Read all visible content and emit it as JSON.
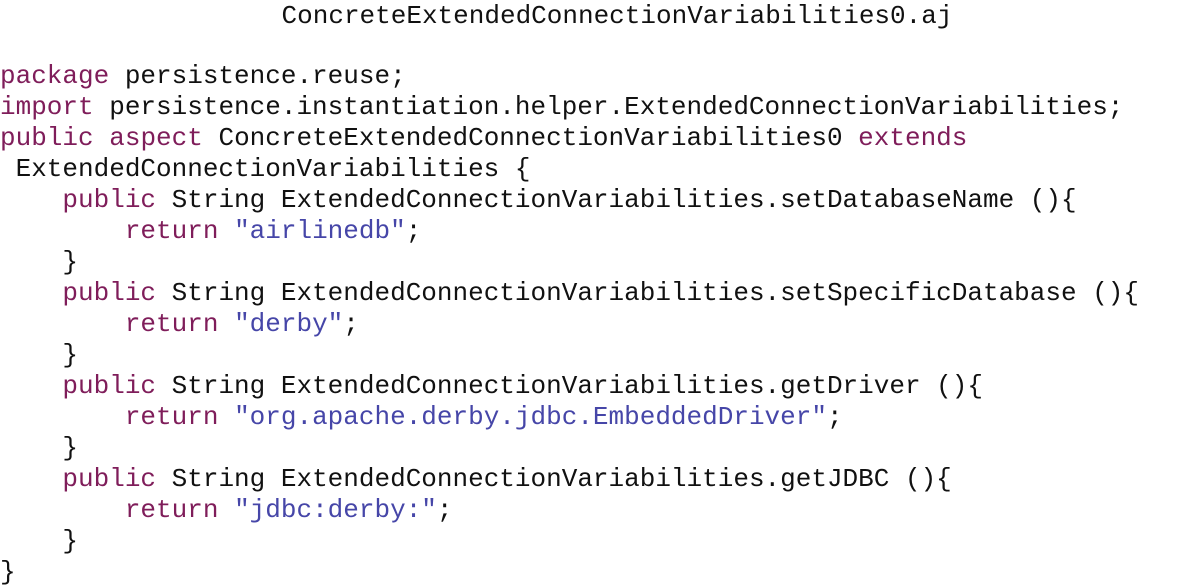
{
  "document": {
    "title": "ConcreteExtendedConnectionVariabilities0.aj",
    "colors": {
      "keyword": "#7f1d5a",
      "string": "#4646a8",
      "text": "#111111",
      "background": "#ffffff"
    },
    "lines": [
      [
        {
          "t": "kw",
          "v": "package"
        },
        {
          "t": "plain",
          "v": " persistence.reuse;"
        }
      ],
      [
        {
          "t": "kw",
          "v": "import"
        },
        {
          "t": "plain",
          "v": " persistence.instantiation.helper.ExtendedConnectionVariabilities;"
        }
      ],
      [
        {
          "t": "kw",
          "v": "public"
        },
        {
          "t": "plain",
          "v": " "
        },
        {
          "t": "kw",
          "v": "aspect"
        },
        {
          "t": "plain",
          "v": " ConcreteExtendedConnectionVariabilities0 "
        },
        {
          "t": "kw",
          "v": "extends"
        }
      ],
      [
        {
          "t": "plain",
          "v": " ExtendedConnectionVariabilities {"
        }
      ],
      [
        {
          "t": "plain",
          "v": "    "
        },
        {
          "t": "kw",
          "v": "public"
        },
        {
          "t": "plain",
          "v": " String ExtendedConnectionVariabilities.setDatabaseName (){"
        }
      ],
      [
        {
          "t": "plain",
          "v": "        "
        },
        {
          "t": "kw",
          "v": "return"
        },
        {
          "t": "plain",
          "v": " "
        },
        {
          "t": "str",
          "v": "\"airlinedb\""
        },
        {
          "t": "plain",
          "v": ";"
        }
      ],
      [
        {
          "t": "plain",
          "v": "    }"
        }
      ],
      [
        {
          "t": "plain",
          "v": "    "
        },
        {
          "t": "kw",
          "v": "public"
        },
        {
          "t": "plain",
          "v": " String ExtendedConnectionVariabilities.setSpecificDatabase (){"
        }
      ],
      [
        {
          "t": "plain",
          "v": "        "
        },
        {
          "t": "kw",
          "v": "return"
        },
        {
          "t": "plain",
          "v": " "
        },
        {
          "t": "str",
          "v": "\"derby\""
        },
        {
          "t": "plain",
          "v": ";"
        }
      ],
      [
        {
          "t": "plain",
          "v": "    }"
        }
      ],
      [
        {
          "t": "plain",
          "v": "    "
        },
        {
          "t": "kw",
          "v": "public"
        },
        {
          "t": "plain",
          "v": " String ExtendedConnectionVariabilities.getDriver (){"
        }
      ],
      [
        {
          "t": "plain",
          "v": "        "
        },
        {
          "t": "kw",
          "v": "return"
        },
        {
          "t": "plain",
          "v": " "
        },
        {
          "t": "str",
          "v": "\"org.apache.derby.jdbc.EmbeddedDriver\""
        },
        {
          "t": "plain",
          "v": ";"
        }
      ],
      [
        {
          "t": "plain",
          "v": "    }"
        }
      ],
      [
        {
          "t": "plain",
          "v": "    "
        },
        {
          "t": "kw",
          "v": "public"
        },
        {
          "t": "plain",
          "v": " String ExtendedConnectionVariabilities.getJDBC (){"
        }
      ],
      [
        {
          "t": "plain",
          "v": "        "
        },
        {
          "t": "kw",
          "v": "return"
        },
        {
          "t": "plain",
          "v": " "
        },
        {
          "t": "str",
          "v": "\"jdbc:derby:\""
        },
        {
          "t": "plain",
          "v": ";"
        }
      ],
      [
        {
          "t": "plain",
          "v": "    }"
        }
      ],
      [
        {
          "t": "plain",
          "v": "}"
        }
      ]
    ]
  }
}
